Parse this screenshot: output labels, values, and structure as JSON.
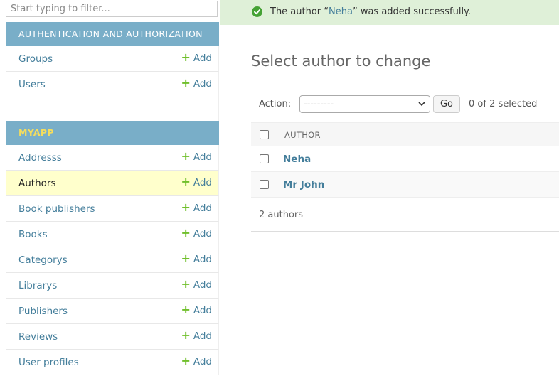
{
  "sidebar": {
    "filter_placeholder": "Start typing to filter...",
    "sections": [
      {
        "title": "AUTHENTICATION AND AUTHORIZATION",
        "models": [
          {
            "label": "Groups",
            "add": "Add"
          },
          {
            "label": "Users",
            "add": "Add"
          }
        ]
      },
      {
        "title": "MYAPP",
        "models": [
          {
            "label": "Addresss",
            "add": "Add"
          },
          {
            "label": "Authors",
            "add": "Add",
            "active": true
          },
          {
            "label": "Book publishers",
            "add": "Add"
          },
          {
            "label": "Books",
            "add": "Add"
          },
          {
            "label": "Categorys",
            "add": "Add"
          },
          {
            "label": "Librarys",
            "add": "Add"
          },
          {
            "label": "Publishers",
            "add": "Add"
          },
          {
            "label": "Reviews",
            "add": "Add"
          },
          {
            "label": "User profiles",
            "add": "Add"
          }
        ]
      }
    ]
  },
  "message": {
    "prefix": "The author “",
    "link": "Neha",
    "suffix": "” was added successfully.",
    "icon": "check-circle-icon"
  },
  "content": {
    "title": "Select author to change",
    "action_label": "Action:",
    "action_selected": "---------",
    "go_label": "Go",
    "selected_count": "0 of 2 selected",
    "column_header": "AUTHOR",
    "rows": [
      "Neha",
      "Mr John"
    ],
    "paginator": "2 authors"
  },
  "colors": {
    "header_bg": "#79aec8",
    "link": "#447e9b",
    "add_plus": "#70bf2b",
    "active_row": "#ffffcc",
    "success_bg": "#dff0d8",
    "myapp_title": "#f5dd5d"
  }
}
